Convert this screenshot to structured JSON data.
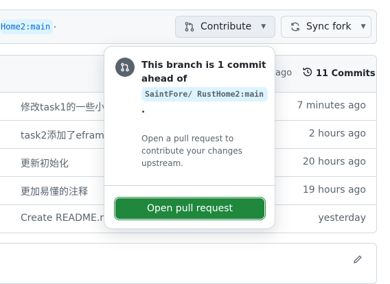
{
  "fork_bar": {
    "branch_chip": "Home2:main",
    "trailing_period": ".",
    "contribute_label": "Contribute",
    "sync_label": "Sync fork"
  },
  "files_header": {
    "ago_partial": "ago",
    "commits_label": "11 Commits"
  },
  "rows": [
    {
      "message": "修改task1的一些小",
      "time": "7 minutes ago"
    },
    {
      "message": "task2添加了eframe",
      "time": "2 hours ago"
    },
    {
      "message": "更新初始化",
      "time": "20 hours ago"
    },
    {
      "message": "更加易懂的注释",
      "time": "19 hours ago"
    },
    {
      "message": "Create README.mc",
      "time": "yesterday"
    }
  ],
  "popover": {
    "title": "This branch is 1 commit ahead of",
    "branch": "SaintFore/ RustHome2:main",
    "period": ".",
    "description": "Open a pull request to contribute your changes upstream.",
    "button_label": "Open pull request"
  },
  "icons": {
    "contribute": "git-pull-request-icon",
    "sync": "sync-icon",
    "commits": "history-icon",
    "popover": "git-pull-request-icon",
    "readme": "pencil-icon"
  },
  "colors": {
    "primary_green": "#1f883d",
    "accent_blue": "#0969da",
    "chip_bg": "#ddf4ff",
    "muted_text": "#59636e"
  }
}
